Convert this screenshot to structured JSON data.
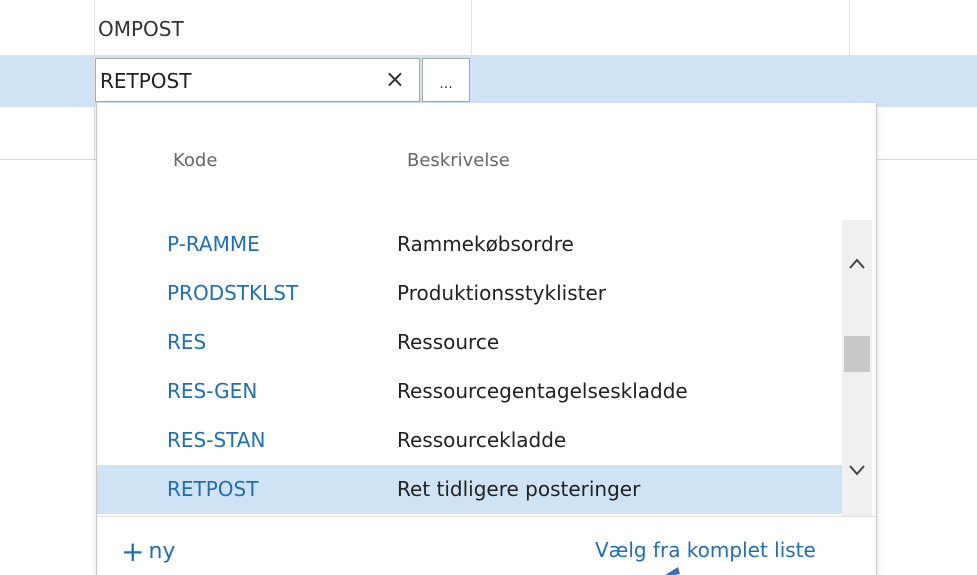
{
  "grid": {
    "row1_value": "OMPOST",
    "edit_value": "RETPOST"
  },
  "input": {
    "clear_icon": "×",
    "lookup_icon": "..."
  },
  "dropdown": {
    "headers": {
      "code": "Kode",
      "description": "Beskrivelse"
    },
    "rows": [
      {
        "code": "P-RAMME",
        "description": "Rammekøbsordre"
      },
      {
        "code": "PRODSTKLST",
        "description": "Produktionsstyklister"
      },
      {
        "code": "RES",
        "description": "Ressource"
      },
      {
        "code": "RES-GEN",
        "description": "Ressourcegentagelseskladde"
      },
      {
        "code": "RES-STAN",
        "description": "Ressourcekladde"
      },
      {
        "code": "RETPOST",
        "description": "Ret tidligere posteringer"
      }
    ],
    "selected_index": 5,
    "scroll_up_icon": "chevron-up",
    "scroll_down_icon": "chevron-down"
  },
  "footer": {
    "new_plus": "+",
    "new_label": "ny",
    "full_list_label": "Vælg fra komplet liste"
  },
  "colors": {
    "accent": "#1f6fb5",
    "selected_row": "#cfe3f4"
  }
}
